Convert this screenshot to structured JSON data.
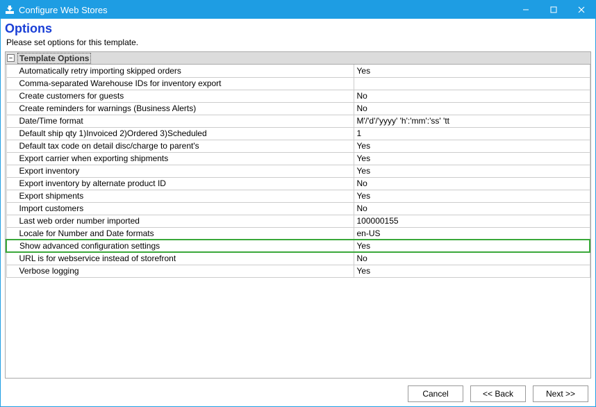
{
  "window": {
    "title": "Configure Web Stores"
  },
  "page": {
    "title": "Options",
    "subtitle": "Please set options for this template."
  },
  "section": {
    "label": "Template Options"
  },
  "options": [
    {
      "label": "Automatically retry importing skipped orders",
      "value": "Yes",
      "highlight": false
    },
    {
      "label": "Comma-separated Warehouse IDs for inventory export",
      "value": "",
      "highlight": false
    },
    {
      "label": "Create customers for guests",
      "value": "No",
      "highlight": false
    },
    {
      "label": "Create reminders for warnings (Business Alerts)",
      "value": "No",
      "highlight": false
    },
    {
      "label": "Date/Time format",
      "value": "M'/'d'/'yyyy' 'h':'mm':'ss' 'tt",
      "highlight": false
    },
    {
      "label": "Default ship qty 1)Invoiced 2)Ordered 3)Scheduled",
      "value": "1",
      "highlight": false
    },
    {
      "label": "Default tax code on detail disc/charge to parent's",
      "value": "Yes",
      "highlight": false
    },
    {
      "label": "Export carrier when exporting shipments",
      "value": "Yes",
      "highlight": false
    },
    {
      "label": "Export inventory",
      "value": "Yes",
      "highlight": false
    },
    {
      "label": "Export inventory by alternate product ID",
      "value": "No",
      "highlight": false
    },
    {
      "label": "Export shipments",
      "value": "Yes",
      "highlight": false
    },
    {
      "label": "Import customers",
      "value": "No",
      "highlight": false
    },
    {
      "label": "Last web order number imported",
      "value": "100000155",
      "highlight": false
    },
    {
      "label": "Locale for Number and Date formats",
      "value": "en-US",
      "highlight": false
    },
    {
      "label": "Show advanced configuration settings",
      "value": "Yes",
      "highlight": true
    },
    {
      "label": "URL is for webservice instead of storefront",
      "value": "No",
      "highlight": false
    },
    {
      "label": "Verbose logging",
      "value": "Yes",
      "highlight": false
    }
  ],
  "buttons": {
    "cancel": "Cancel",
    "back": "<< Back",
    "next": "Next >>"
  }
}
